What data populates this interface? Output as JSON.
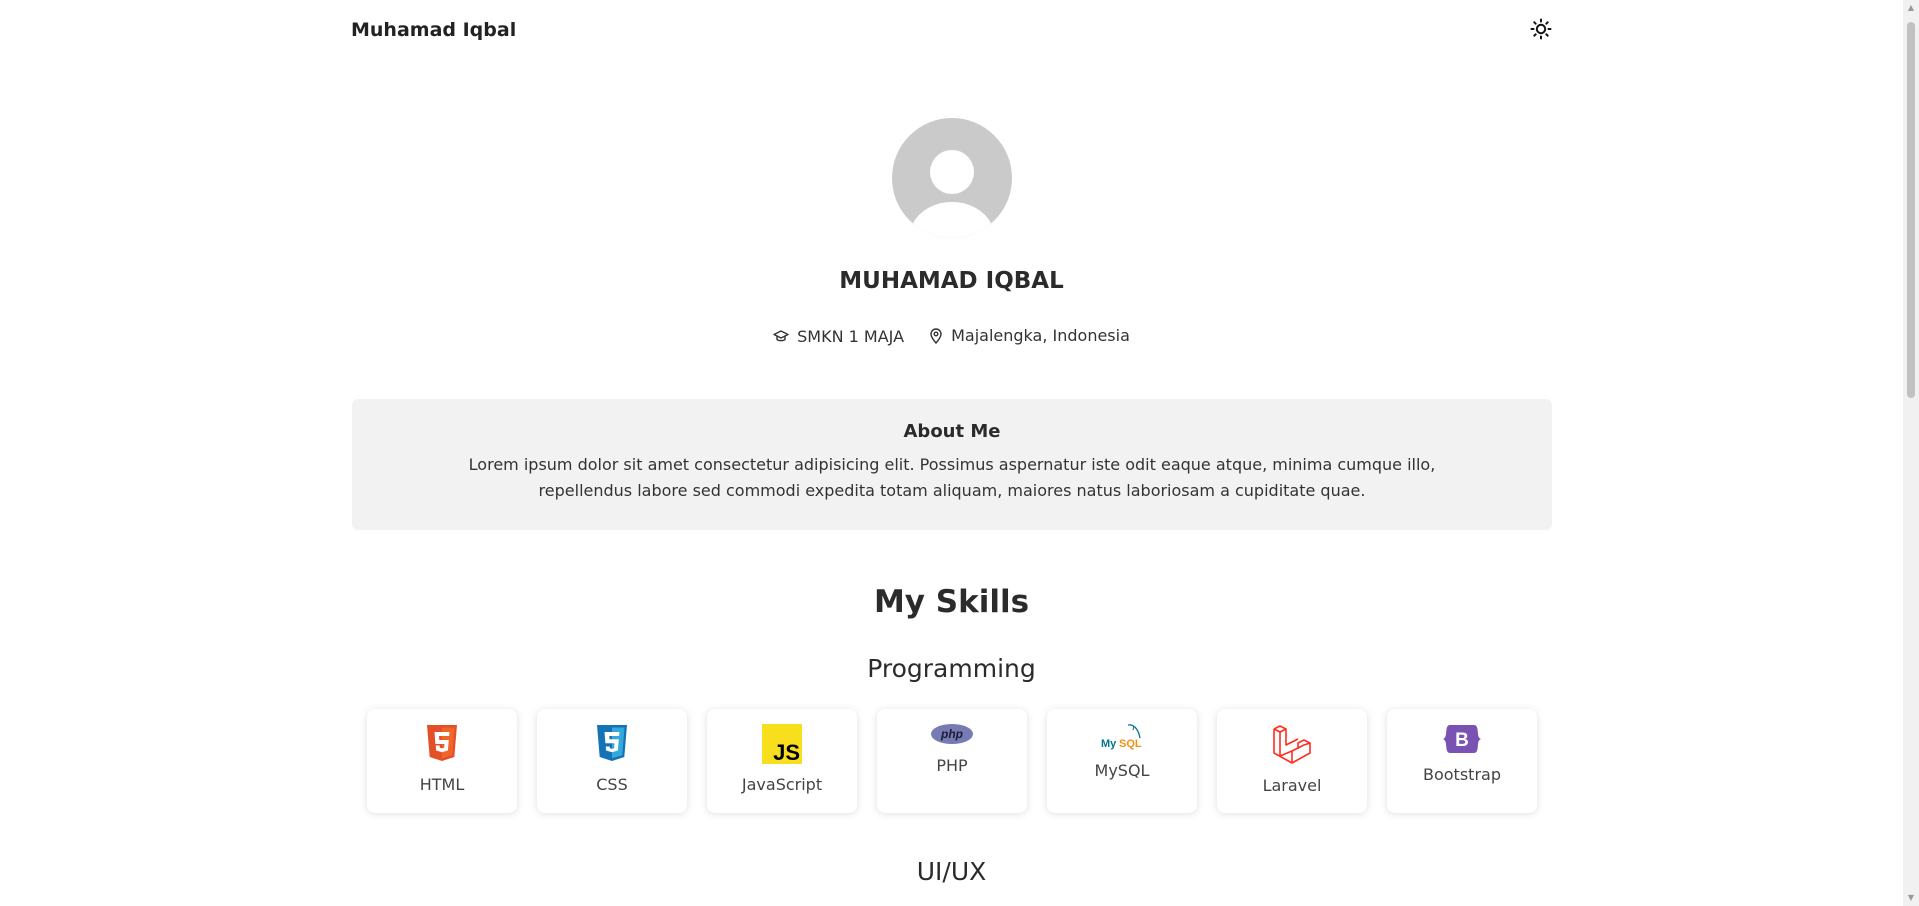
{
  "navbar": {
    "brand": "Muhamad Iqbal",
    "theme_icon": "sun-icon"
  },
  "profile": {
    "name": "MUHAMAD IQBAL",
    "school": "SMKN 1 MAJA",
    "location": "Majalengka, Indonesia"
  },
  "about": {
    "title": "About Me",
    "text": "Lorem ipsum dolor sit amet consectetur adipisicing elit. Possimus aspernatur iste odit eaque atque, minima cumque illo, repellendus labore sed commodi expedita totam aliquam, maiores natus laboriosam a cupiditate quae."
  },
  "skills": {
    "title": "My Skills",
    "programming": {
      "title": "Programming",
      "items": [
        {
          "label": "HTML",
          "icon": "html5-icon",
          "color": "#e34f26"
        },
        {
          "label": "CSS",
          "icon": "css3-icon",
          "color": "#1572b6"
        },
        {
          "label": "JavaScript",
          "icon": "javascript-icon",
          "color": "#f7df1e"
        },
        {
          "label": "PHP",
          "icon": "php-icon",
          "color": "#777bb3"
        },
        {
          "label": "MySQL",
          "icon": "mysql-icon",
          "color": "#00758f"
        },
        {
          "label": "Laravel",
          "icon": "laravel-icon",
          "color": "#ff2d20"
        },
        {
          "label": "Bootstrap",
          "icon": "bootstrap-icon",
          "color": "#7952b3"
        }
      ]
    },
    "uiux": {
      "title": "UI/UX"
    }
  }
}
